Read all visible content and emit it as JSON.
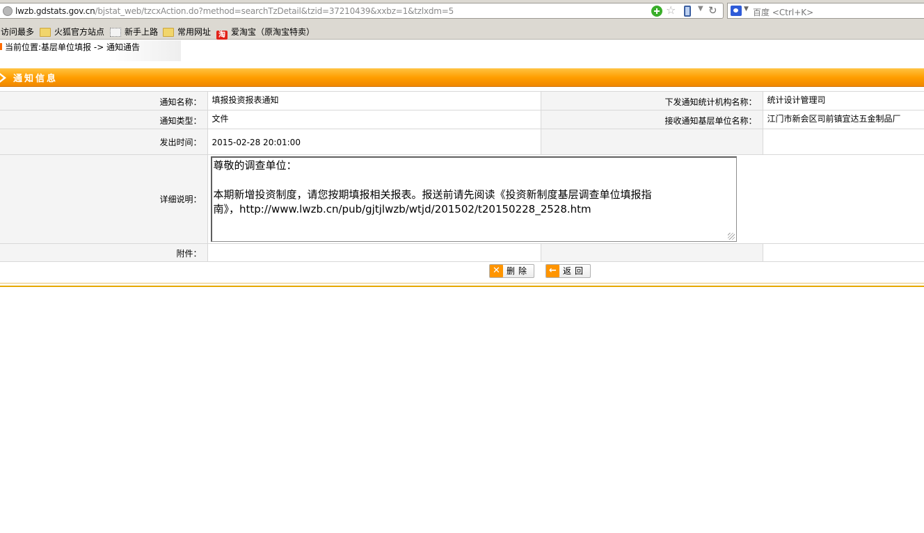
{
  "browser": {
    "url_host": "lwzb.gdstats.gov.cn",
    "url_rest": "/bjstat_web/tzcxAction.do?method=searchTzDetail&tzid=37210439&xxbz=1&tzlxdm=5",
    "search_placeholder": "百度 <Ctrl+K>"
  },
  "bookmarks": [
    {
      "label": "访问最多",
      "icon": "none"
    },
    {
      "label": "火狐官方站点",
      "icon": "folder-icon"
    },
    {
      "label": "新手上路",
      "icon": "page-icon"
    },
    {
      "label": "常用网址",
      "icon": "folder-icon"
    },
    {
      "label": "爱淘宝（原淘宝特卖）",
      "icon": "taobao-icon"
    }
  ],
  "breadcrumb": "当前位置:基层单位填报 -> 通知通告",
  "section_title": "通知信息",
  "form": {
    "notice_name_label": "通知名称：",
    "notice_name": "填报投资报表通知",
    "issuer_label": "下发通知统计机构名称：",
    "issuer": "统计设计管理司",
    "notice_type_label": "通知类型：",
    "notice_type": "文件",
    "receiver_label": "接收通知基层单位名称：",
    "receiver": "江门市新会区司前镇宜达五金制品厂",
    "issue_time_label": "发出时间：",
    "issue_time": "2015-02-28 20:01:00",
    "detail_label": "详细说明：",
    "detail_line1": "尊敬的调查单位：",
    "detail_line2": "本期新增投资制度，请您按期填报相关报表。报送前请先阅读《投资新制度基层调查单位填报指",
    "detail_line3": "南》，http://www.lwzb.cn/pub/gjtjlwzb/wtjd/201502/t20150228_2528.htm",
    "attachment_label": "附件："
  },
  "buttons": {
    "delete_label": "删除",
    "back_label": "返回"
  }
}
